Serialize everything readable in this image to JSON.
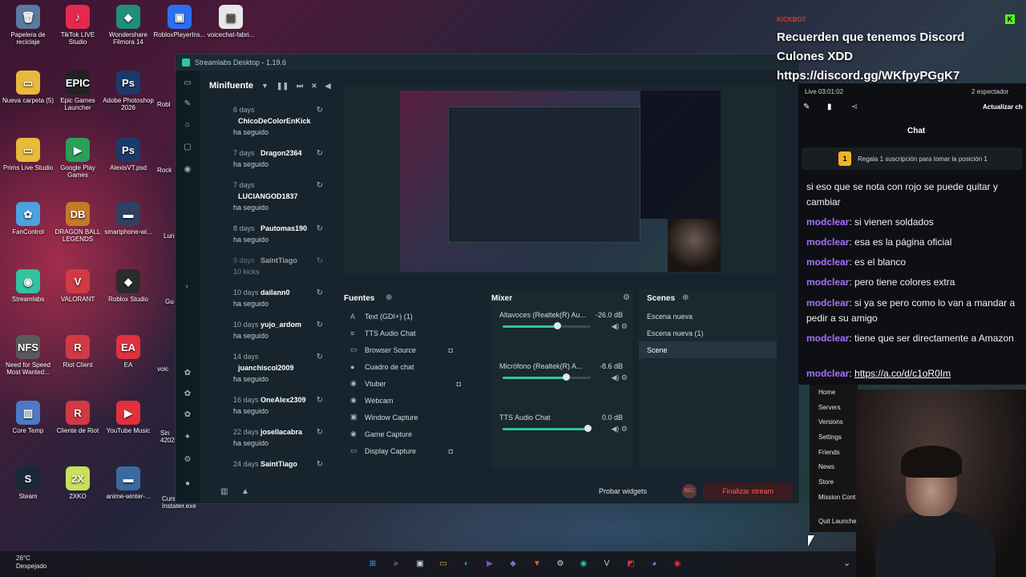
{
  "desktop": {
    "icons": [
      {
        "label": "Papelera de reciclaje",
        "color": "#5a7aa0",
        "glyph": "🗑"
      },
      {
        "label": "TikTok LIVE Studio",
        "color": "#e5284d",
        "glyph": "♪"
      },
      {
        "label": "Wondershare Filmora 14",
        "color": "#1d8f7a",
        "glyph": "◆"
      },
      {
        "label": "RobloxPlayerIns...",
        "color": "#2b6ff0",
        "glyph": "▣"
      },
      {
        "label": "voicechat-fabri...",
        "color": "#e8e8e8",
        "glyph": "▤"
      },
      {
        "label": "Nueva carpeta (5)",
        "color": "#e8b93a",
        "glyph": "▭"
      },
      {
        "label": "Epic Games Launcher",
        "color": "#222222",
        "glyph": "EPIC"
      },
      {
        "label": "Adobe Photoshop 2026",
        "color": "#1b3a6b",
        "glyph": "Ps"
      },
      {
        "label": "Prims Live Studio",
        "color": "#e8b93a",
        "glyph": "▭"
      },
      {
        "label": "Google Play Games",
        "color": "#2aa05a",
        "glyph": "▶"
      },
      {
        "label": "AlexisVT.psd",
        "color": "#1b3a6b",
        "glyph": "Ps"
      },
      {
        "label": "FanControl",
        "color": "#4aa3df",
        "glyph": "✿"
      },
      {
        "label": "DRAGON BALL LEGENDS",
        "color": "#c47a2a",
        "glyph": "DB"
      },
      {
        "label": "smartphone-wi...",
        "color": "#304060",
        "glyph": "▬"
      },
      {
        "label": "Streamlabs",
        "color": "#31c3a2",
        "glyph": "◉"
      },
      {
        "label": "VALORANT",
        "color": "#d13a45",
        "glyph": "V"
      },
      {
        "label": "Roblox Studio",
        "color": "#2b2b2b",
        "glyph": "◆"
      },
      {
        "label": "Need for Speed Most Wanted...",
        "color": "#5a5a5a",
        "glyph": "NFS"
      },
      {
        "label": "Riot Client",
        "color": "#d13a45",
        "glyph": "R"
      },
      {
        "label": "EA",
        "color": "#e0313d",
        "glyph": "EA"
      },
      {
        "label": "Core Temp",
        "color": "#4a7ac8",
        "glyph": "▥"
      },
      {
        "label": "Cliente de Riot",
        "color": "#d13a45",
        "glyph": "R"
      },
      {
        "label": "YouTube Music",
        "color": "#e0313d",
        "glyph": "▶"
      },
      {
        "label": "Steam",
        "color": "#1b2838",
        "glyph": "S"
      },
      {
        "label": "2XKO",
        "color": "#c8e05a",
        "glyph": "2X"
      },
      {
        "label": "anime-winter-...",
        "color": "#3a6aa0",
        "glyph": "▬"
      }
    ],
    "partial_labels": [
      "Robl",
      "Rock",
      "Lun",
      "Gu",
      "voic",
      "Sin 42027",
      "Curs Installer.exe"
    ]
  },
  "streamlabs": {
    "title": "Streamlabs Desktop - 1.19.6",
    "events_title": "Minifuente",
    "events": [
      {
        "days": "6 days",
        "name": "ChicoDeColorEnKick",
        "action": "ha seguido",
        "layout": "tall"
      },
      {
        "days": "7 days",
        "name": "Dragon2364",
        "action": "ha seguido",
        "layout": "inline"
      },
      {
        "days": "7 days",
        "name": "LUCIANGOD1837",
        "action": "ha seguido",
        "layout": "tall"
      },
      {
        "days": "8 days",
        "name": "Pautomas190",
        "action": "ha seguido",
        "layout": "inline"
      },
      {
        "days": "9 days",
        "name": "SaintTiago",
        "action": "10 kicks",
        "layout": "inline",
        "dim": true
      },
      {
        "days": "10 days",
        "name": "dailann0",
        "action": "ha seguido",
        "layout": "inline"
      },
      {
        "days": "10 days",
        "name": "yujo_ardom",
        "action": "ha seguido",
        "layout": "inline"
      },
      {
        "days": "14 days",
        "name": "juanchiscol2009",
        "action": "ha seguido",
        "layout": "tall"
      },
      {
        "days": "16 days",
        "name": "OneAlex2309",
        "action": "ha seguido",
        "layout": "inline"
      },
      {
        "days": "22 days",
        "name": "josellacabra",
        "action": "ha seguido",
        "layout": "inline"
      },
      {
        "days": "24 days",
        "name": "SaintTiago",
        "action": "",
        "layout": "inline"
      }
    ],
    "sources_title": "Fuentes",
    "sources": [
      {
        "label": "Text (GDI+) (1)",
        "icon": "A"
      },
      {
        "label": "TTS Audio Chat",
        "icon": "≡"
      },
      {
        "label": "Browser Source",
        "icon": "▭"
      },
      {
        "label": "Cuadro de chat",
        "icon": "●"
      },
      {
        "label": "Vtuber",
        "icon": "◉"
      },
      {
        "label": "Webcam",
        "icon": "◉"
      },
      {
        "label": "Window Capture",
        "icon": "▣"
      },
      {
        "label": "Game Capture",
        "icon": "◉"
      },
      {
        "label": "Display Capture",
        "icon": "▭"
      }
    ],
    "mixer_title": "Mixer",
    "mixer": [
      {
        "label": "Altavoces (Realtek(R) Au...",
        "db": "-26.0 dB",
        "level": 0.62
      },
      {
        "label": "Micrófono (Realtek(R) A...",
        "db": "-8.6 dB",
        "level": 0.72
      },
      {
        "label": "TTS Audio Chat",
        "db": "0.0 dB",
        "level": 0.96
      }
    ],
    "scenes_title": "Scenes",
    "scenes": [
      "Escena nueva",
      "Escena nueva (1)",
      "Scene"
    ],
    "active_scene": 2,
    "footer": {
      "widgets": "Probar widgets",
      "rec": "REC",
      "end": "Finalizar stream"
    }
  },
  "overlay": {
    "kick_tag": "KICKBOT",
    "message": [
      "Recuerden que tenemos Discord",
      "Culones XDD",
      "https://discord.gg/WKfpyPGgK7"
    ]
  },
  "chat": {
    "live": "Live 03:01:02",
    "viewers": "2 espectador",
    "update": "Actualizar ch",
    "title": "Chat",
    "gift_rank": "1",
    "gift_text": "Regala 1 suscripción para tomar la posición 1",
    "messages": [
      {
        "user": "",
        "text": "si eso que se nota con rojo se puede quitar y cambiar",
        "partial": true
      },
      {
        "user": "modclear",
        "text": "si vienen soldados"
      },
      {
        "user": "modclear",
        "text": "esa es la página oficial"
      },
      {
        "user": "modclear",
        "text": "es el blanco"
      },
      {
        "user": "modclear",
        "text": "pero tiene colores extra"
      },
      {
        "user": "modclear",
        "text": "si ya se pero como lo van a mandar a pedir a su amigo"
      },
      {
        "user": "modclear",
        "text": "tiene que ser directamente a Amazon"
      },
      {
        "user": "modclear",
        "text": "https://a.co/d/c1oR0Im",
        "link": true
      }
    ]
  },
  "context_menu": [
    "Home",
    "Servers",
    "Versions",
    "Settings",
    "Friends",
    "News",
    "Store",
    "Mission Cont",
    "Quit Launche"
  ],
  "taskbar": {
    "temp": "26°C",
    "weather": "Despejado",
    "icons": [
      {
        "name": "windows-start-icon",
        "glyph": "⊞",
        "color": "#3aa0ff"
      },
      {
        "name": "search-icon",
        "glyph": "⌕",
        "color": "#cfd6db"
      },
      {
        "name": "task-view-icon",
        "glyph": "▣",
        "color": "#cfd6db"
      },
      {
        "name": "file-explorer-icon",
        "glyph": "▭",
        "color": "#e8b93a"
      },
      {
        "name": "edge-icon",
        "glyph": "◐",
        "color": "#2aa0d8"
      },
      {
        "name": "media-player-icon",
        "glyph": "▶",
        "color": "#6a5acd"
      },
      {
        "name": "app-icon",
        "glyph": "◆",
        "color": "#6a7ac8"
      },
      {
        "name": "brave-icon",
        "glyph": "▼",
        "color": "#f25c2a"
      },
      {
        "name": "gear-app-icon",
        "glyph": "⚙",
        "color": "#cfd6db"
      },
      {
        "name": "streamlabs-icon",
        "glyph": "◉",
        "color": "#31c3a2"
      },
      {
        "name": "vegas-icon",
        "glyph": "V",
        "color": "#cfd6db"
      },
      {
        "name": "studio-icon",
        "glyph": "◩",
        "color": "#d13a45"
      },
      {
        "name": "discord-icon",
        "glyph": "◕",
        "color": "#7289da"
      },
      {
        "name": "recorder-icon",
        "glyph": "◉",
        "color": "#e0313d"
      }
    ],
    "tray": "⌄"
  }
}
